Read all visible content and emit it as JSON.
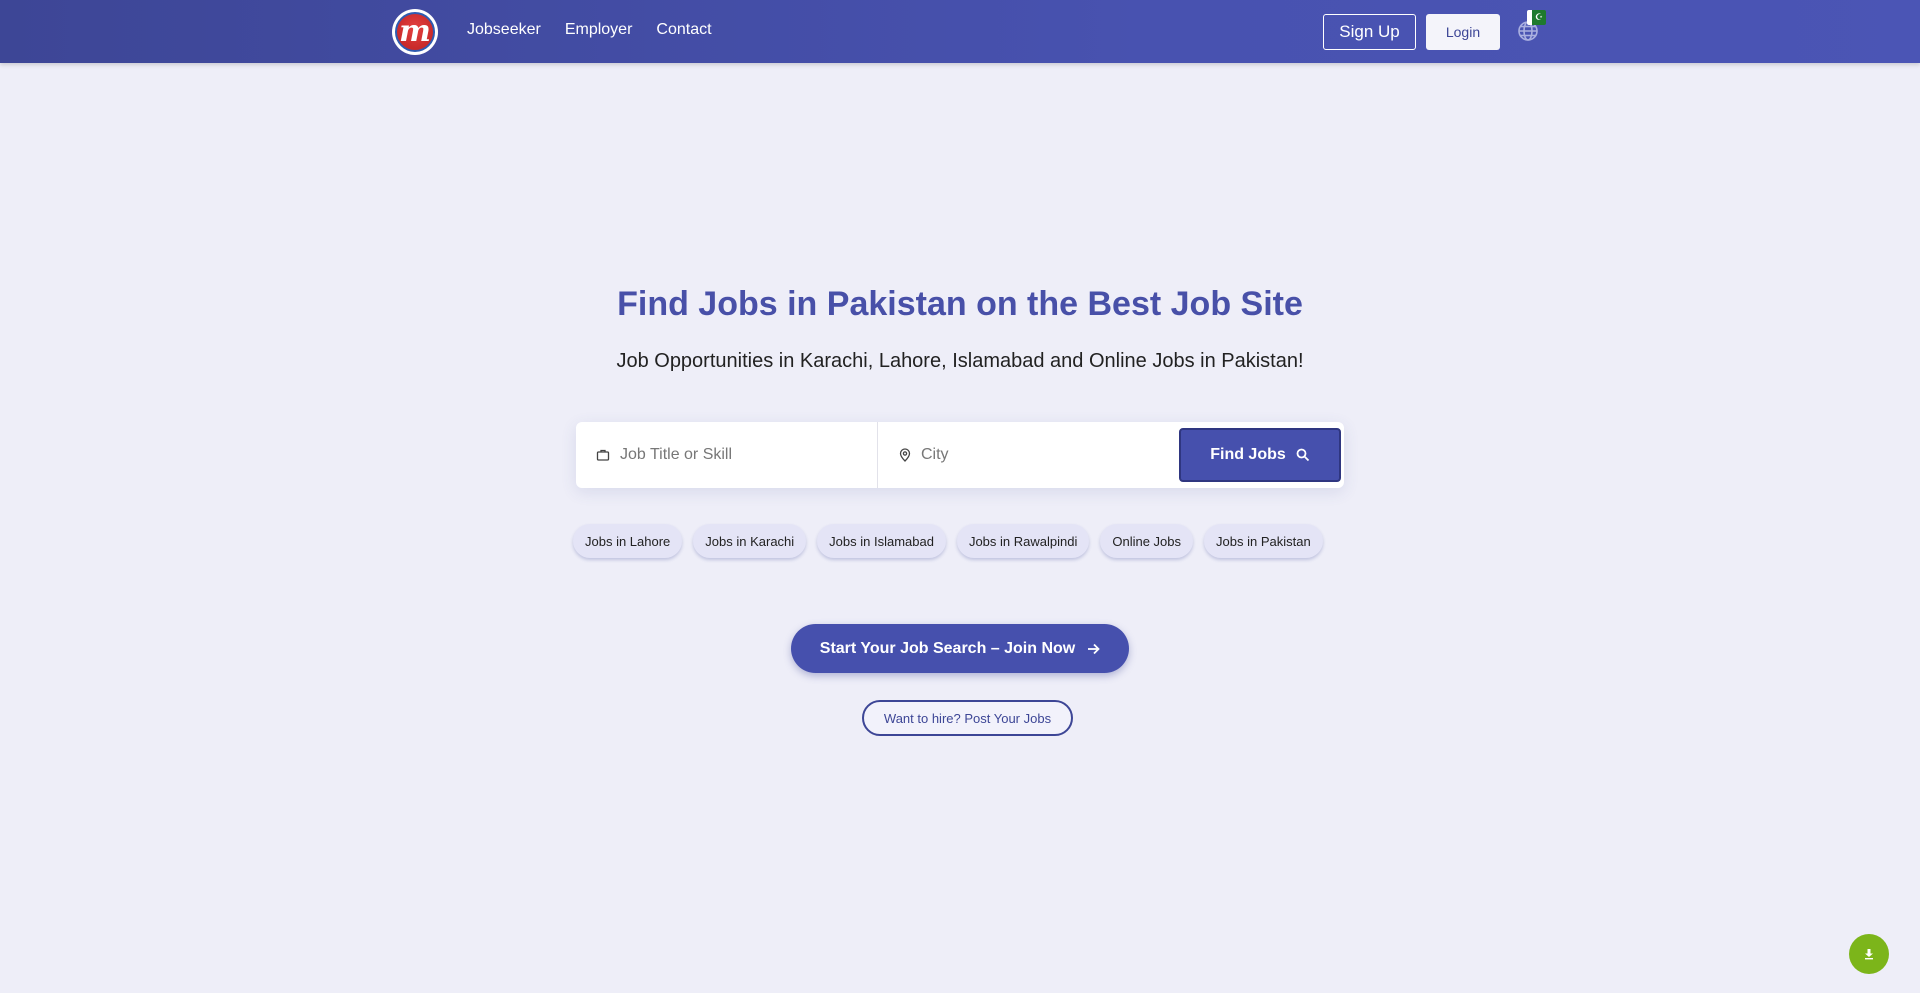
{
  "nav": {
    "logo_letter": "m",
    "links": [
      "Jobseeker",
      "Employer",
      "Contact"
    ],
    "signup_label": "Sign Up",
    "login_label": "Login",
    "flag_symbol": "☪"
  },
  "hero": {
    "title": "Find Jobs in Pakistan on the Best Job Site",
    "subtitle": "Job Opportunities in Karachi, Lahore, Islamabad and Online Jobs in Pakistan!"
  },
  "search": {
    "job_placeholder": "Job Title or Skill",
    "city_placeholder": "City",
    "find_label": "Find Jobs"
  },
  "chips": [
    "Jobs in Lahore",
    "Jobs in Karachi",
    "Jobs in Islamabad",
    "Jobs in Rawalpindi",
    "Online Jobs",
    "Jobs in Pakistan"
  ],
  "cta": {
    "join_label": "Start Your Job Search – Join Now",
    "hire_label": "Want to hire? Post Your Jobs"
  },
  "colors": {
    "primary": "#4650ad",
    "title": "#4850a8",
    "fab": "#7cb51a"
  },
  "icons": {
    "job": "briefcase-icon",
    "city": "location-pin-icon",
    "find": "search-icon",
    "join": "arrow-right-icon",
    "language": "globe-icon",
    "fab": "download-icon"
  }
}
